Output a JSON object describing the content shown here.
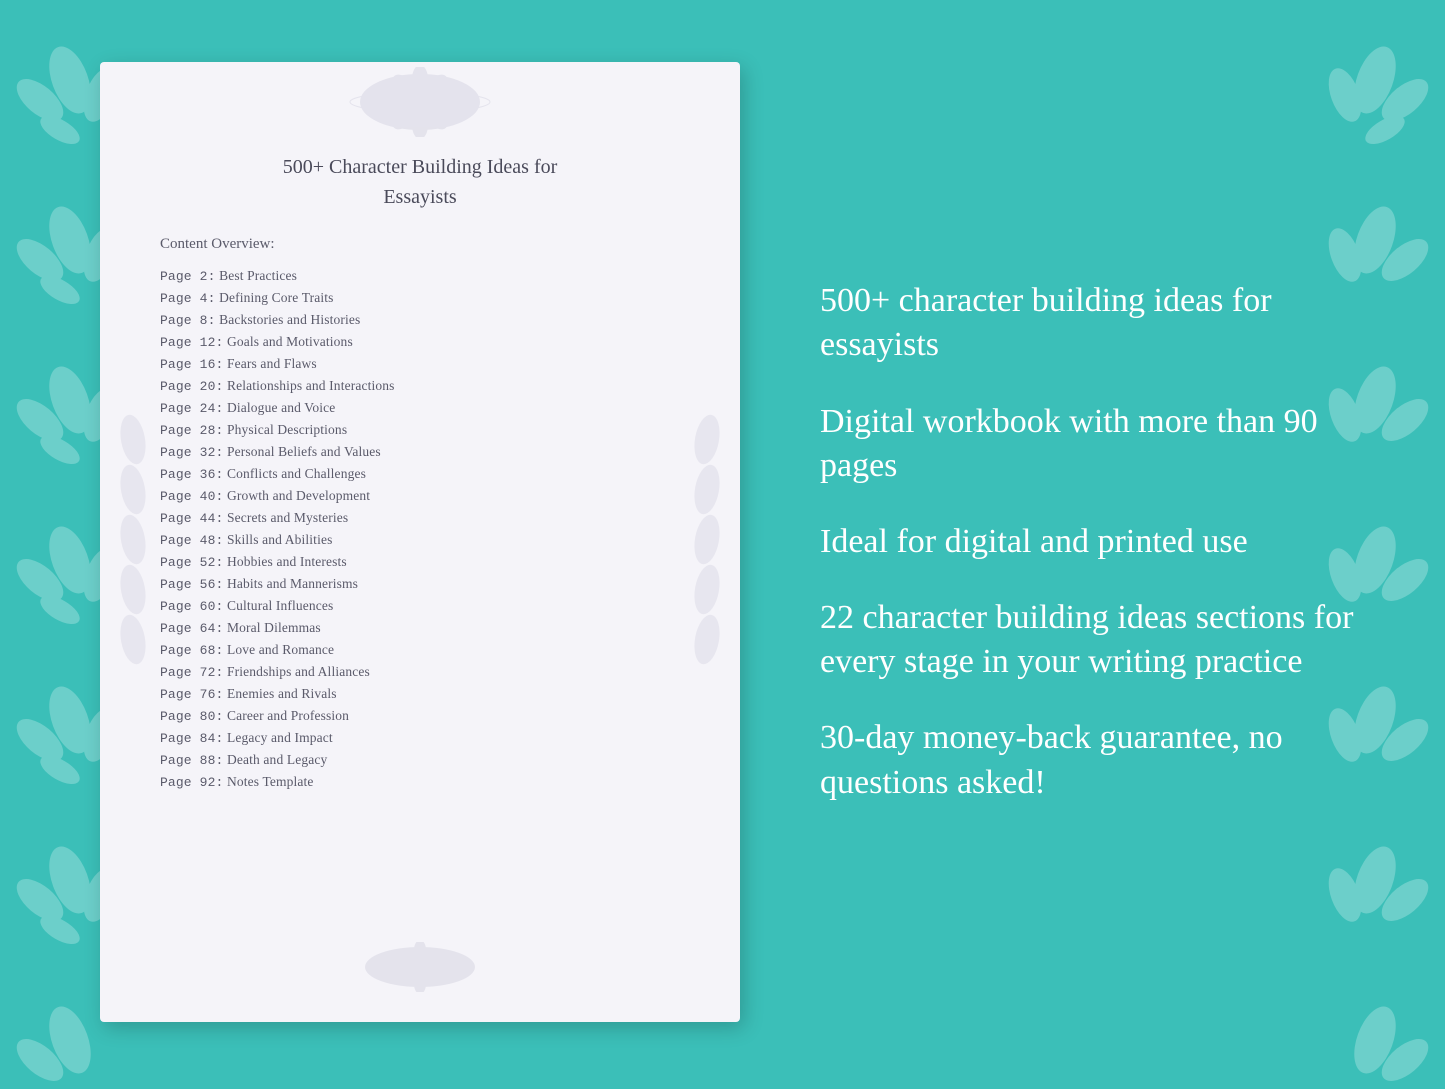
{
  "background_color": "#3bbfb8",
  "book": {
    "title_line1": "500+ Character Building Ideas for",
    "title_line2": "Essayists",
    "content_overview_label": "Content Overview:",
    "toc_items": [
      {
        "page": "Page  2:",
        "title": "Best Practices"
      },
      {
        "page": "Page  4:",
        "title": "Defining Core Traits"
      },
      {
        "page": "Page  8:",
        "title": "Backstories and Histories"
      },
      {
        "page": "Page 12:",
        "title": "Goals and Motivations"
      },
      {
        "page": "Page 16:",
        "title": "Fears and Flaws"
      },
      {
        "page": "Page 20:",
        "title": "Relationships and Interactions"
      },
      {
        "page": "Page 24:",
        "title": "Dialogue and Voice"
      },
      {
        "page": "Page 28:",
        "title": "Physical Descriptions"
      },
      {
        "page": "Page 32:",
        "title": "Personal Beliefs and Values"
      },
      {
        "page": "Page 36:",
        "title": "Conflicts and Challenges"
      },
      {
        "page": "Page 40:",
        "title": "Growth and Development"
      },
      {
        "page": "Page 44:",
        "title": "Secrets and Mysteries"
      },
      {
        "page": "Page 48:",
        "title": "Skills and Abilities"
      },
      {
        "page": "Page 52:",
        "title": "Hobbies and Interests"
      },
      {
        "page": "Page 56:",
        "title": "Habits and Mannerisms"
      },
      {
        "page": "Page 60:",
        "title": "Cultural Influences"
      },
      {
        "page": "Page 64:",
        "title": "Moral Dilemmas"
      },
      {
        "page": "Page 68:",
        "title": "Love and Romance"
      },
      {
        "page": "Page 72:",
        "title": "Friendships and Alliances"
      },
      {
        "page": "Page 76:",
        "title": "Enemies and Rivals"
      },
      {
        "page": "Page 80:",
        "title": "Career and Profession"
      },
      {
        "page": "Page 84:",
        "title": "Legacy and Impact"
      },
      {
        "page": "Page 88:",
        "title": "Death and Legacy"
      },
      {
        "page": "Page 92:",
        "title": "Notes Template"
      }
    ]
  },
  "features": [
    "500+ character building ideas for essayists",
    "Digital workbook with more than 90 pages",
    "Ideal for digital and printed use",
    "22 character building ideas sections for every stage in your writing practice",
    "30-day money-back guarantee, no questions asked!"
  ]
}
